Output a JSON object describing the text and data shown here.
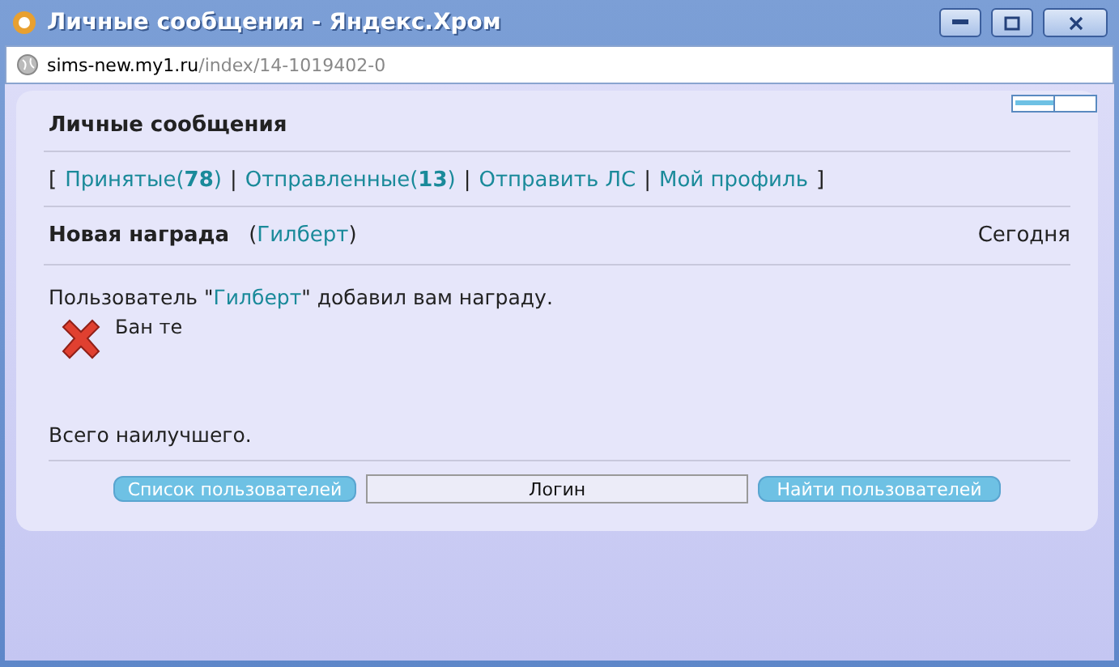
{
  "window": {
    "title": "Личные сообщения - Яндекс.Хром"
  },
  "address": {
    "host": "sims-new.my1.ru",
    "path": "/index/14-1019402-0"
  },
  "heading": "Личные сообщения",
  "nav": [
    {
      "kind": "bracket",
      "label": "["
    },
    {
      "kind": "link",
      "label": "Принятые(",
      "count": "78",
      "close": ")"
    },
    {
      "kind": "separator",
      "label": "|"
    },
    {
      "kind": "link",
      "label": "Отправленные(",
      "count": "13",
      "close": ")"
    },
    {
      "kind": "separator",
      "label": "|"
    },
    {
      "kind": "link",
      "label": "Отправить ЛС"
    },
    {
      "kind": "separator",
      "label": "|"
    },
    {
      "kind": "link",
      "label": "Мой профиль"
    },
    {
      "kind": "bracket",
      "label": "]"
    }
  ],
  "message": {
    "subject": "Новая награда",
    "sender_open": "(",
    "sender": "Гилберт",
    "sender_close": ")",
    "date": "Сегодня",
    "body_before": "Пользователь \"",
    "body_link": "Гилберт",
    "body_after": "\" добавил вам награду.",
    "award": "Бан те",
    "closing": "Всего наилучшего."
  },
  "footer": {
    "left_button": "Список пользователей",
    "login_value": "Логин",
    "right_button": "Найти пользователей"
  }
}
